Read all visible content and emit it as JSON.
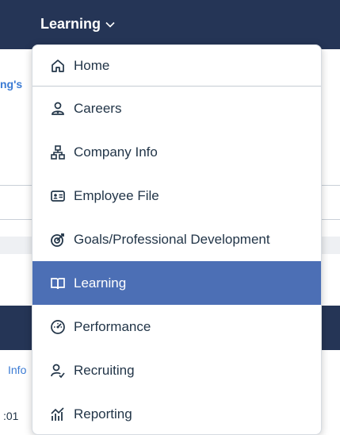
{
  "topbar": {
    "title": "Learning"
  },
  "background": {
    "left_text": "ng's",
    "info_text": "Info",
    "time_text": ":01"
  },
  "menu": {
    "items": [
      {
        "label": "Home",
        "icon": "home-icon"
      },
      {
        "label": "Careers",
        "icon": "careers-icon"
      },
      {
        "label": "Company Info",
        "icon": "org-chart-icon"
      },
      {
        "label": "Employee File",
        "icon": "id-card-icon"
      },
      {
        "label": "Goals/Professional Development",
        "icon": "target-icon"
      },
      {
        "label": "Learning",
        "icon": "book-icon",
        "selected": true
      },
      {
        "label": "Performance",
        "icon": "gauge-icon"
      },
      {
        "label": "Recruiting",
        "icon": "recruiting-icon"
      },
      {
        "label": "Reporting",
        "icon": "chart-icon"
      }
    ]
  },
  "colors": {
    "shell": "#253556",
    "selected": "#4c6fb5",
    "link": "#3b7bd4",
    "text": "#223548"
  }
}
